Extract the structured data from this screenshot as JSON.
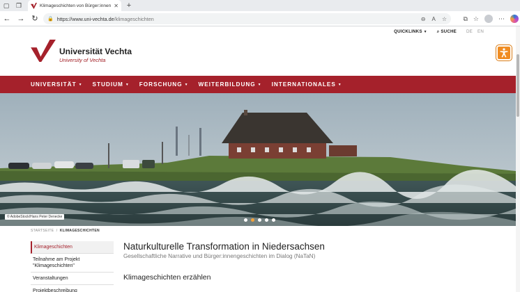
{
  "browser": {
    "tab_title": "Klimageschichten von Bürger:innen",
    "url_host": "https://www.uni-vechta.de",
    "url_path": "/klimageschichten"
  },
  "utility": {
    "quicklinks": "QUICKLINKS",
    "search": "SUCHE",
    "lang_de": "DE",
    "lang_en": "EN"
  },
  "logo": {
    "name": "Universität Vechta",
    "subtitle": "University of Vechta"
  },
  "nav": {
    "items": [
      {
        "label": "UNIVERSITÄT"
      },
      {
        "label": "STUDIUM"
      },
      {
        "label": "FORSCHUNG"
      },
      {
        "label": "WEITERBILDUNG"
      },
      {
        "label": "INTERNATIONALES"
      }
    ]
  },
  "hero": {
    "credit": "© AdobeStock/Hans Peter Denecke",
    "slides": 5,
    "active_slide": 2
  },
  "breadcrumb": {
    "home": "STARTSEITE",
    "sep": "/",
    "current": "KLIMAGESCHICHTEN"
  },
  "sidenav": {
    "items": [
      {
        "label": "Klimageschichten"
      },
      {
        "label": "Teilnahme am Projekt \"Klimageschichten\""
      },
      {
        "label": "Veranstaltungen"
      },
      {
        "label": "Projektbeschreibung"
      }
    ]
  },
  "content": {
    "title": "Naturkulturelle Transformation in Niedersachsen",
    "subtitle": "Gesellschaftliche Narrative und Bürger:innengeschichten im Dialog (NaTaN)",
    "section_title": "Klimageschichten erzählen"
  },
  "colors": {
    "brand_red": "#a5212b",
    "accessibility_orange": "#f08c22"
  }
}
